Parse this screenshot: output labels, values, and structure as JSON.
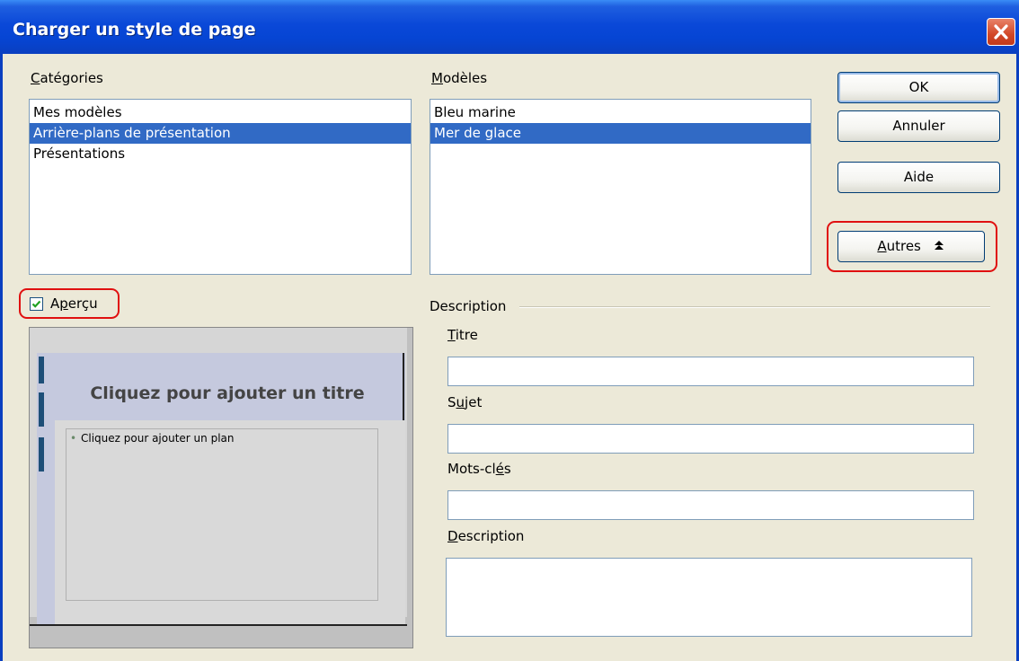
{
  "dialog": {
    "title": "Charger un style de page"
  },
  "categories": {
    "label": "Catégories",
    "items": [
      {
        "label": "Mes modèles",
        "selected": false
      },
      {
        "label": "Arrière-plans de présentation",
        "selected": true
      },
      {
        "label": "Présentations",
        "selected": false
      }
    ]
  },
  "models": {
    "label": "Modèles",
    "items": [
      {
        "label": "Bleu marine",
        "selected": false
      },
      {
        "label": "Mer de glace",
        "selected": true
      }
    ]
  },
  "buttons": {
    "ok": "OK",
    "cancel": "Annuler",
    "help": "Aide",
    "more": "Autres"
  },
  "preview": {
    "checkbox_label": "Aperçu",
    "checked": true,
    "slide_title": "Cliquez pour ajouter un titre",
    "slide_outline": "Cliquez pour ajouter un plan"
  },
  "description_group": {
    "label": "Description",
    "fields": {
      "title": {
        "label": "Titre",
        "value": ""
      },
      "subject": {
        "label": "Sujet",
        "value": ""
      },
      "keywords": {
        "label": "Mots-clés",
        "value": ""
      },
      "description": {
        "label": "Description",
        "value": ""
      }
    }
  },
  "colors": {
    "titlebar": "#0a48d8",
    "selection": "#316ac5",
    "annotation": "#e01010",
    "dialog_bg": "#ece9d8"
  }
}
